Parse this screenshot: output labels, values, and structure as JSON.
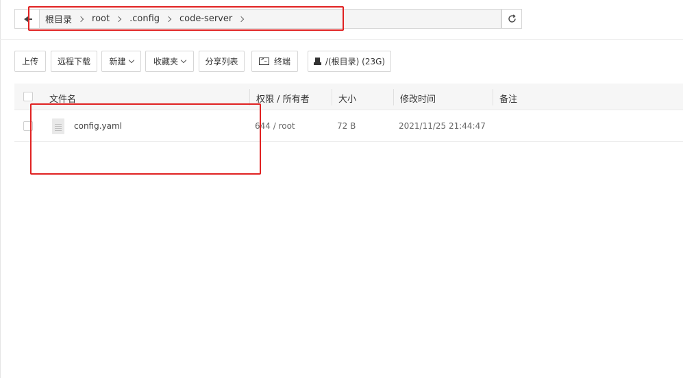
{
  "breadcrumb": {
    "items": [
      "根目录",
      "root",
      ".config",
      "code-server"
    ]
  },
  "toolbar": {
    "upload": "上传",
    "remote_download": "远程下载",
    "new": "新建",
    "favorites": "收藏夹",
    "share_list": "分享列表",
    "terminal": "终端",
    "disk": "/(根目录) (23G)"
  },
  "table": {
    "headers": {
      "name": "文件名",
      "permission": "权限 / 所有者",
      "size": "大小",
      "modified": "修改时间",
      "note": "备注"
    },
    "rows": [
      {
        "name": "config.yaml",
        "permission": "644 / root",
        "size": "72 B",
        "modified": "2021/11/25 21:44:47",
        "note": ""
      }
    ]
  },
  "colors": {
    "annotation": "#e02020",
    "header_bg": "#f6f6f6",
    "border": "#d6d6d6"
  }
}
